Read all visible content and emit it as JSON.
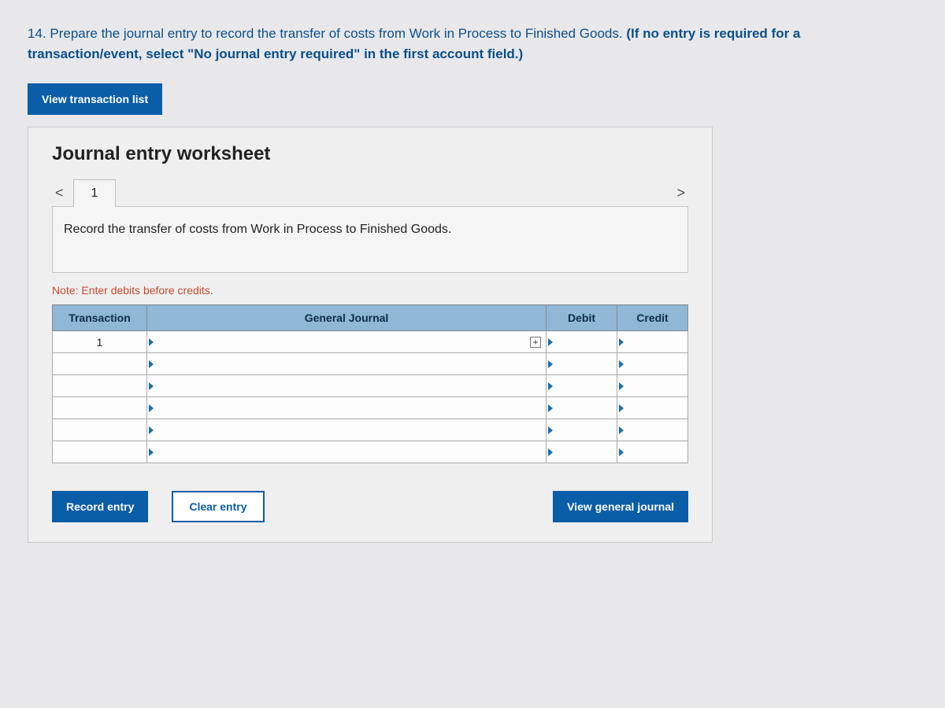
{
  "question": {
    "number": "14.",
    "text": "Prepare the journal entry to record the transfer of costs from Work in Process to Finished Goods. ",
    "bold": "(If no entry is required for a transaction/event, select \"No journal entry required\" in the first account field.)"
  },
  "buttons": {
    "view_list": "View transaction list",
    "record": "Record entry",
    "clear": "Clear entry",
    "view_journal": "View general journal"
  },
  "worksheet": {
    "title": "Journal entry worksheet",
    "tab": "1",
    "prompt": "Record the transfer of costs from Work in Process to Finished Goods.",
    "note": "Note: Enter debits before credits.",
    "headers": {
      "transaction": "Transaction",
      "general_journal": "General Journal",
      "debit": "Debit",
      "credit": "Credit"
    },
    "rows": [
      {
        "transaction": "1"
      },
      {},
      {},
      {},
      {},
      {}
    ]
  },
  "nav": {
    "prev": "<",
    "next": ">"
  },
  "icons": {
    "plus": "+"
  }
}
